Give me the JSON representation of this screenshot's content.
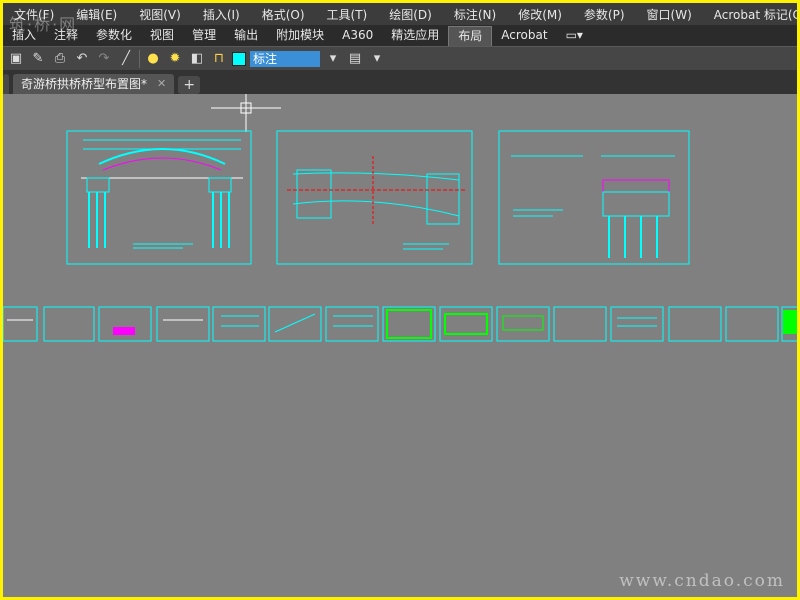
{
  "menu": [
    "文件(F)",
    "编辑(E)",
    "视图(V)",
    "插入(I)",
    "格式(O)",
    "工具(T)",
    "绘图(D)",
    "标注(N)",
    "修改(M)",
    "参数(P)",
    "窗口(W)",
    "Acrobat 标记(C)"
  ],
  "ribbon_tabs": [
    "插入",
    "注释",
    "参数化",
    "视图",
    "管理",
    "输出",
    "附加模块",
    "A360",
    "精选应用",
    "布局",
    "Acrobat"
  ],
  "active_ribbon_tab": "布局",
  "toolbar": {
    "layer_name": "标注",
    "layer_color": "#00ffff"
  },
  "document_tab": "奇游桥拱桥桥型布置图*",
  "watermark_top": "筑·桥·网",
  "watermark_bottom": "www.cndao.com",
  "icons": [
    "save-icon",
    "save-as-icon",
    "print-icon",
    "undo-icon",
    "redo-icon",
    "line-tool-icon",
    "bulb-icon",
    "sun-icon",
    "layer-icon",
    "lock-icon"
  ],
  "colors": {
    "drawing_line": "#00ffff",
    "canvas": "#808080",
    "highlight_green": "#00ff00",
    "highlight_magenta": "#ff00ff"
  }
}
